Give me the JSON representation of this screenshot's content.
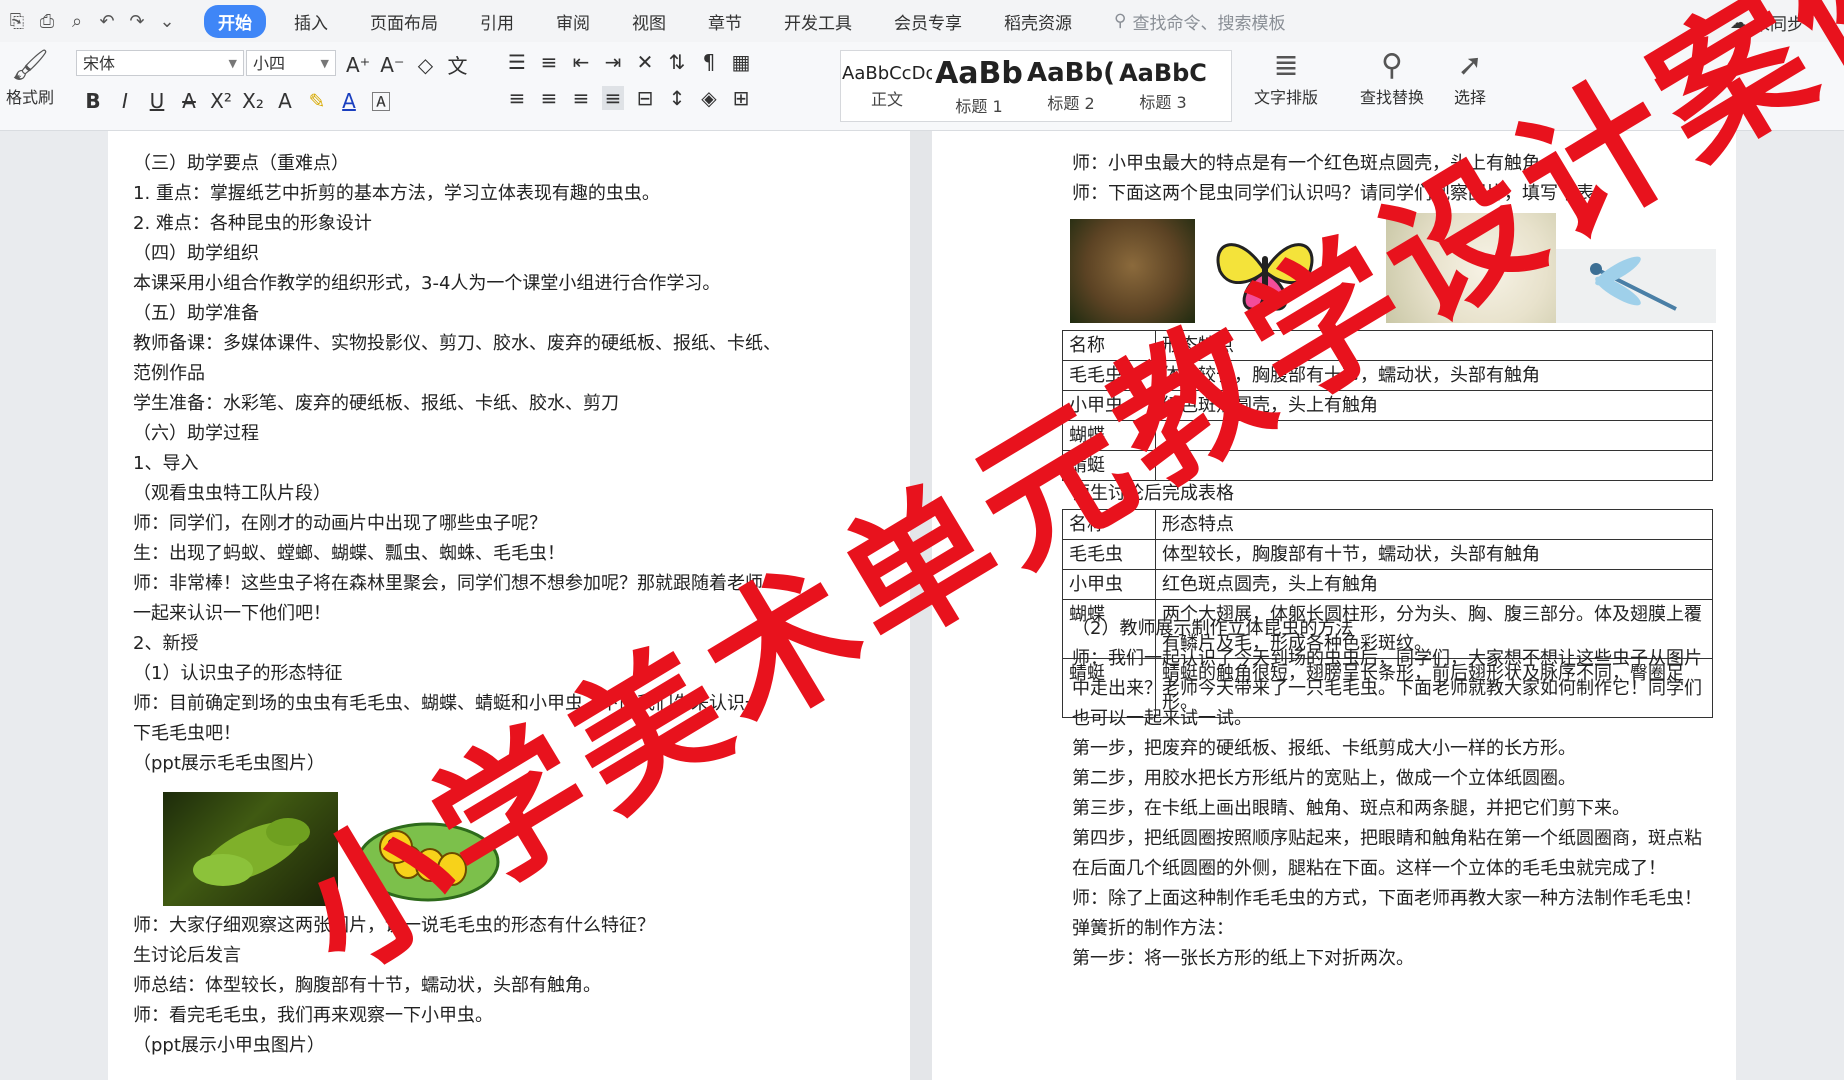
{
  "tabs": [
    "开始",
    "插入",
    "页面布局",
    "引用",
    "审阅",
    "视图",
    "章节",
    "开发工具",
    "会员专享",
    "稻壳资源"
  ],
  "search_placeholder": "查找命令、搜索模板",
  "sync_label": "未同步",
  "ribbon": {
    "format_painter": "格式刷",
    "font_name": "宋体",
    "font_size": "小四",
    "styles": [
      {
        "sample": "AaBbCcDd",
        "name": "正文"
      },
      {
        "sample": "AaBb",
        "name": "标题 1"
      },
      {
        "sample": "AaBb(",
        "name": "标题 2"
      },
      {
        "sample": "AaBbC",
        "name": "标题 3"
      }
    ],
    "text_layout": "文字排版",
    "find_replace": "查找替换",
    "select": "选择"
  },
  "left_page": {
    "lines_top": [
      "（三）助学要点（重难点）",
      "1. 重点：掌握纸艺中折剪的基本方法，学习立体表现有趣的虫虫。",
      "2. 难点：各种昆虫的形象设计",
      "（四）助学组织",
      "本课采用小组合作教学的组织形式，3-4人为一个课堂小组进行合作学习。",
      "（五）助学准备",
      "教师备课：多媒体课件、实物投影仪、剪刀、胶水、废弃的硬纸板、报纸、卡纸、",
      "范例作品",
      "学生准备：水彩笔、废弃的硬纸板、报纸、卡纸、胶水、剪刀",
      "（六）助学过程",
      "1、导入",
      "（观看虫虫特工队片段）",
      "师：同学们，在刚才的动画片中出现了哪些虫子呢？",
      "生：出现了蚂蚁、螳螂、蝴蝶、瓢虫、蜘蛛、毛毛虫！",
      "师：非常棒！这些虫子将在森林里聚会，同学们想不想参加呢？那就跟随着老师",
      "一起来认识一下他们吧！",
      "2、新授",
      "（1）认识虫子的形态特征",
      "师：目前确定到场的虫虫有毛毛虫、蝴蝶、蜻蜓和小甲虫，下面我们先来认识一",
      "下毛毛虫吧！",
      "（ppt展示毛毛虫图片）"
    ],
    "lines_bottom": [
      "师：大家仔细观察这两张图片，说一说毛毛虫的形态有什么特征？",
      "生讨论后发言",
      "师总结：体型较长，胸腹部有十节，蠕动状，头部有触角。",
      "师：看完毛毛虫，我们再来观察一下小甲虫。",
      "（ppt展示小甲虫图片）"
    ]
  },
  "right_page": {
    "lines_top": [
      "师：小甲虫最大的特点是有一个红色斑点圆壳，头上有触角。",
      "师：下面这两个昆虫同学们认识吗？请同学们观察图片，填写下表。"
    ],
    "table1": [
      [
        "名称",
        "形态特点"
      ],
      [
        "毛毛虫",
        "体型较长，胸腹部有十节，蠕动状，头部有触角"
      ],
      [
        "小甲虫",
        "红色斑点圆壳，头上有触角"
      ],
      [
        "蝴蝶",
        ""
      ],
      [
        "蜻蜓",
        ""
      ]
    ],
    "table_caption": "师生讨论后完成表格",
    "table2": [
      [
        "名称",
        "形态特点"
      ],
      [
        "毛毛虫",
        "体型较长，胸腹部有十节，蠕动状，头部有触角"
      ],
      [
        "小甲虫",
        "红色斑点圆壳，头上有触角"
      ],
      [
        "蝴蝶",
        "两个大翅展，体躯长圆柱形，分为头、胸、腹三部分。体及翅膜上覆有鳞片及毛，形成各种色彩斑纹。"
      ],
      [
        "蜻蜓",
        "蜻蜓的触角很短，翅膀呈长条形，前后翅形状及脉序不同，臀圈足形。"
      ]
    ],
    "lines_bottom": [
      "（2）教师展示制作立体昆虫的方法",
      "师：我们一起认识了今天到场的虫虫后，同学们，大家想不想让这些虫子从图片",
      "中走出来？老师今天带来了一只毛毛虫。下面老师就教大家如何制作它！同学们",
      "也可以一起来试一试。",
      "第一步，把废弃的硬纸板、报纸、卡纸剪成大小一样的长方形。",
      "第二步，用胶水把长方形纸片的宽贴上，做成一个立体纸圆圈。",
      "第三步，在卡纸上画出眼睛、触角、斑点和两条腿，并把它们剪下来。",
      "第四步，把纸圆圈按照顺序贴起来，把眼睛和触角粘在第一个纸圆圈商，斑点粘",
      "在后面几个纸圆圈的外侧，腿粘在下面。这样一个立体的毛毛虫就完成了！",
      "师：除了上面这种制作毛毛虫的方式，下面老师再教大家一种方法制作毛毛虫！",
      "弹簧折的制作方法：",
      "第一步：将一张长方形的纸上下对折两次。"
    ]
  },
  "watermark": "小学美术单元教学设计案例"
}
